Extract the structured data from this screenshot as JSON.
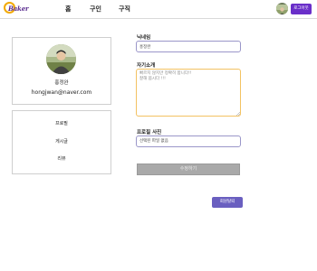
{
  "header": {
    "logo_text": "Baker",
    "nav": [
      {
        "label": "홈"
      },
      {
        "label": "구인"
      },
      {
        "label": "구직"
      }
    ],
    "logout_label": "로그아웃",
    "calendar_icon": "calendar-edit-icon",
    "accent_color": "#6a2fc9"
  },
  "profile": {
    "name": "홍정완",
    "email": "hongjwan@naver.com"
  },
  "menu": {
    "items": [
      {
        "label": "프로필"
      },
      {
        "label": "게시글"
      },
      {
        "label": "리뷰"
      }
    ]
  },
  "form": {
    "nickname_label": "닉네임",
    "nickname_value": "홍정완",
    "intro_label": "자기소개",
    "intro_placeholder": "빠르지 않지만 정확히 합니다!!\n잘해 봅시다 !!!",
    "photo_label": "프로필 사진",
    "photo_button": "선택된 파일 없음",
    "submit_label": "수정하기",
    "withdraw_label": "회원탈퇴"
  }
}
